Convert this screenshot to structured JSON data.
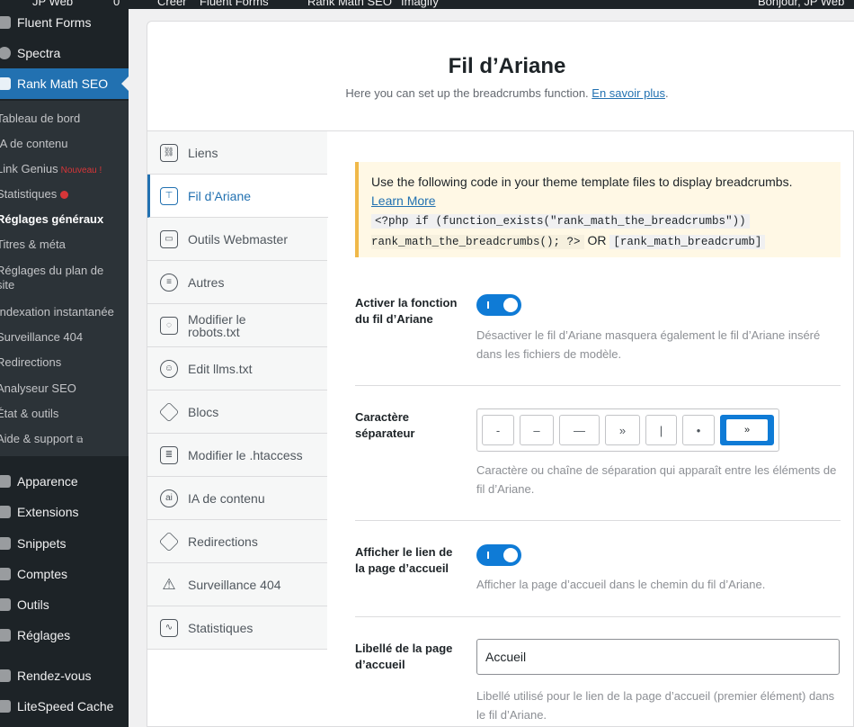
{
  "admin_bar": {
    "items": [
      "JP Web",
      "0",
      "Créer",
      "Fluent Forms",
      "Rank Math SEO",
      "Imagify"
    ],
    "greeting": "Bonjour, JP Web"
  },
  "sidebar": {
    "top_items": [
      {
        "label": "Fluent Forms",
        "icon": "fluent-forms-icon"
      },
      {
        "label": "Spectra",
        "icon": "spectra-icon"
      },
      {
        "label": "Rank Math SEO",
        "icon": "rank-math-icon",
        "active": true
      }
    ],
    "submenu": [
      {
        "label": "Tableau de bord"
      },
      {
        "label": "IA de contenu"
      },
      {
        "label": "Link Genius",
        "badge": "Nouveau !"
      },
      {
        "label": "Statistiques",
        "dot": true
      },
      {
        "label": "Réglages généraux",
        "current": true
      },
      {
        "label": "Titres & méta"
      },
      {
        "label": "Réglages du plan de site"
      },
      {
        "label": "Indexation instantanée"
      },
      {
        "label": "Surveillance 404"
      },
      {
        "label": "Redirections"
      },
      {
        "label": "Analyseur SEO"
      },
      {
        "label": "État & outils"
      },
      {
        "label": "Aide & support",
        "external": true
      }
    ],
    "bottom_items": [
      {
        "label": "Apparence",
        "icon": "appearance-icon"
      },
      {
        "label": "Extensions",
        "icon": "plugins-icon"
      },
      {
        "label": "Snippets",
        "icon": "snippets-icon"
      },
      {
        "label": "Comptes",
        "icon": "users-icon"
      },
      {
        "label": "Outils",
        "icon": "tools-icon"
      },
      {
        "label": "Réglages",
        "icon": "settings-icon"
      },
      {
        "label": "Rendez-vous",
        "icon": "calendar-icon"
      },
      {
        "label": "LiteSpeed Cache",
        "icon": "litespeed-icon"
      }
    ]
  },
  "header": {
    "title": "Fil d’Ariane",
    "description": "Here you can set up the breadcrumbs function.",
    "learn_more": "En savoir plus"
  },
  "tabs": [
    {
      "label": "Liens",
      "icon": "link-icon"
    },
    {
      "label": "Fil d’Ariane",
      "icon": "breadcrumb-icon",
      "active": true
    },
    {
      "label": "Outils Webmaster",
      "icon": "toolbox-icon"
    },
    {
      "label": "Autres",
      "icon": "list-icon"
    },
    {
      "label": "Modifier le robots.txt",
      "icon": "robots-file-icon"
    },
    {
      "label": "Edit llms.txt",
      "icon": "llms-icon"
    },
    {
      "label": "Blocs",
      "icon": "blocks-icon"
    },
    {
      "label": "Modifier le .htaccess",
      "icon": "htaccess-icon"
    },
    {
      "label": "IA de contenu",
      "icon": "ai-icon"
    },
    {
      "label": "Redirections",
      "icon": "redirect-icon"
    },
    {
      "label": "Surveillance 404",
      "icon": "warning-icon"
    },
    {
      "label": "Statistiques",
      "icon": "chart-icon"
    }
  ],
  "notice": {
    "text": "Use the following code in your theme template files to display breadcrumbs.",
    "learn_more": "Learn More",
    "code1": "<?php if (function_exists(\"rank_math_the_breadcrumbs\"))",
    "code2": "rank_math_the_breadcrumbs(); ?>",
    "or": "OR",
    "code3": "[rank_math_breadcrumb]"
  },
  "settings": {
    "enable": {
      "label": "Activer la fonction du fil d’Ariane",
      "enabled": true,
      "description": "Désactiver le fil d’Ariane masquera également le fil d’Ariane inséré dans les fichiers de modèle."
    },
    "separator": {
      "label": "Caractère séparateur",
      "options": [
        "-",
        "–",
        "—",
        "»",
        "|",
        "•",
        "»"
      ],
      "selected_index": 6,
      "description": "Caractère ou chaîne de séparation qui apparaît entre les éléments de fil d’Ariane."
    },
    "home_link": {
      "label": "Afficher le lien de la page d’accueil",
      "enabled": true,
      "description": "Afficher la page d’accueil dans le chemin du fil d’Ariane."
    },
    "home_label": {
      "label": "Libellé de la page d’accueil",
      "value": "Accueil",
      "description": "Libellé utilisé pour le lien de la page d’accueil (premier élément) dans le fil d’Ariane."
    }
  },
  "colors": {
    "accent": "#2271b1",
    "toggle": "#0f7bd6",
    "sidebar_bg": "#1d2327",
    "notice_bg": "#fff8e5"
  }
}
